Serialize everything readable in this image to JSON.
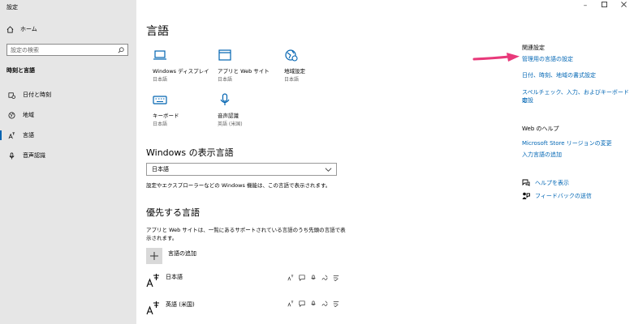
{
  "window": {
    "title": "設定"
  },
  "sidebar": {
    "home_label": "ホーム",
    "search_placeholder": "設定の検索",
    "section_title": "時刻と言語",
    "items": [
      {
        "label": "日付と時刻",
        "icon": "calendar-clock-icon"
      },
      {
        "label": "地域",
        "icon": "globe-icon"
      },
      {
        "label": "言語",
        "icon": "language-icon",
        "selected": true
      },
      {
        "label": "音声認識",
        "icon": "microphone-icon"
      }
    ]
  },
  "main": {
    "title": "言語",
    "tiles": [
      {
        "label": "Windows ディスプレイ",
        "sub": "日本語",
        "icon": "laptop-icon"
      },
      {
        "label": "アプリと Web サイト",
        "sub": "日本語",
        "icon": "window-icon"
      },
      {
        "label": "地域設定",
        "sub": "日本語",
        "icon": "globe-clock-icon"
      },
      {
        "label": "キーボード",
        "sub": "日本語",
        "icon": "keyboard-icon"
      },
      {
        "label": "音声認識",
        "sub": "英語 (米国)",
        "icon": "microphone-icon"
      }
    ],
    "display_lang_title": "Windows の表示言語",
    "display_lang_value": "日本語",
    "display_lang_desc": "設定やエクスプローラーなどの Windows 機能は、この言語で表示されます。",
    "preferred_title": "優先する言語",
    "preferred_desc_1": "アプリと Web サイトは、一覧にあるサポートされている言語のうち先頭の言語で表",
    "preferred_desc_2": "示されます。",
    "add_language": "言語の追加",
    "languages": [
      {
        "name": "日本語"
      },
      {
        "name": "英語 (米国)"
      }
    ]
  },
  "right": {
    "related_title": "関連設定",
    "related_links": [
      "管理用の言語の設定",
      "日付、時刻、地域の書式設定",
      "スペルチェック、入力、およびキーボードの設",
      "定"
    ],
    "web_help_title": "Web のヘルプ",
    "web_links": [
      "Microsoft Store リージョンの変更",
      "入力言語の追加"
    ],
    "help_label": "ヘルプを表示",
    "feedback_label": "フィードバックの送信"
  },
  "colors": {
    "accent": "#0063b1",
    "link": "#0066b4",
    "arrow": "#e8397a",
    "sidebar_bg": "#e6e6e6"
  }
}
